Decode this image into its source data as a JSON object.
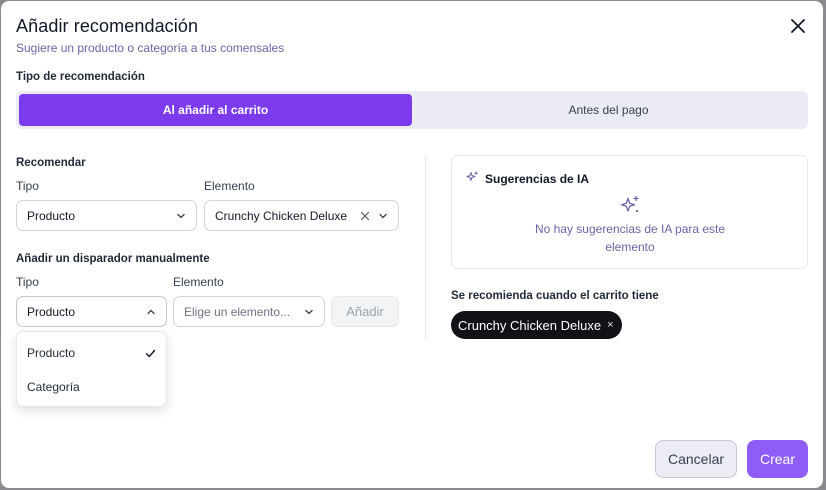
{
  "dialog": {
    "title": "Añadir recomendación",
    "subtitle": "Sugiere un producto o categoría a tus comensales"
  },
  "recommendation_type": {
    "label": "Tipo de recomendación",
    "options": [
      {
        "label": "Al añadir al carrito",
        "active": true
      },
      {
        "label": "Antes del pago",
        "active": false
      }
    ]
  },
  "recommend": {
    "section_label": "Recomendar",
    "type_label": "Tipo",
    "type_value": "Producto",
    "element_label": "Elemento",
    "element_value": "Crunchy Chicken Deluxe"
  },
  "manual_trigger": {
    "section_label": "Añadir un disparador manualmente",
    "type_label": "Tipo",
    "type_value": "Producto",
    "element_label": "Elemento",
    "element_placeholder": "Elige un elemento...",
    "add_button": "Añadir",
    "dropdown_options": [
      {
        "label": "Producto",
        "selected": true
      },
      {
        "label": "Categoría",
        "selected": false
      }
    ]
  },
  "ai_suggestions": {
    "title": "Sugerencias de IA",
    "empty_text": "No hay sugerencias de IA para este elemento"
  },
  "cart_trigger": {
    "label": "Se recomienda cuando el carrito tiene",
    "chip": "Crunchy Chicken Deluxe",
    "chip_remove": "×"
  },
  "footer": {
    "cancel": "Cancelar",
    "create": "Crear"
  },
  "colors": {
    "accent": "#7c3aed",
    "create_button": "#8f5cf7",
    "chip_bg": "#111118",
    "segment_bg": "#ebebf3"
  },
  "icons": {
    "close": "close-icon",
    "chevron_down": "chevron-down-icon",
    "chevron_up": "chevron-up-icon",
    "clear": "clear-icon",
    "sparkles": "sparkles-icon",
    "check": "check-icon"
  }
}
